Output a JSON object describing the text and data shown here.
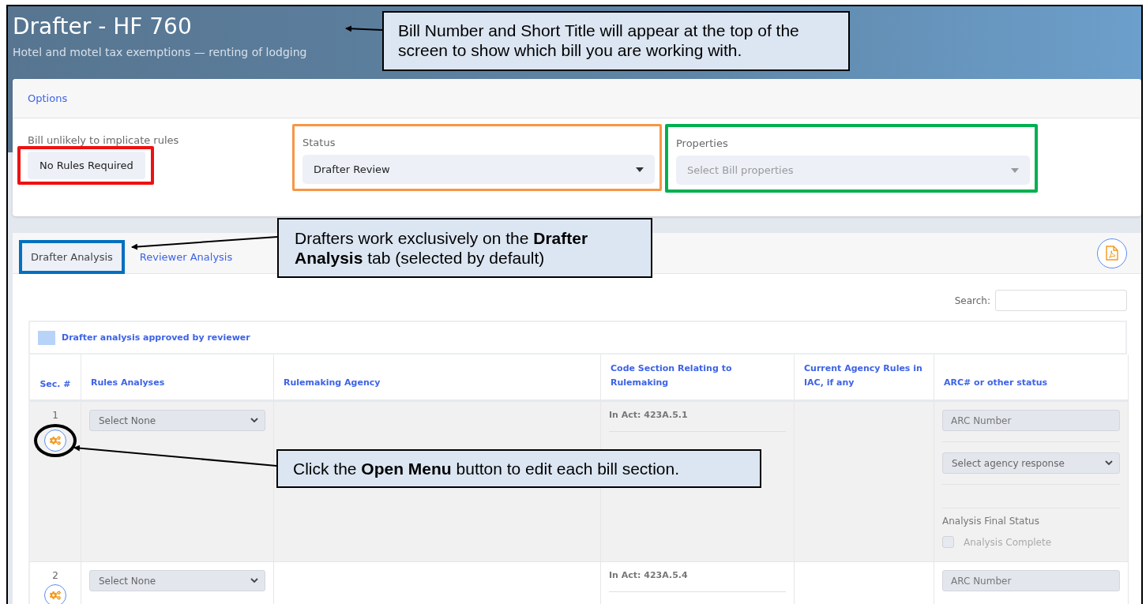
{
  "header": {
    "title": "Drafter - HF 760",
    "subtitle": "Hotel and motel tax exemptions — renting of lodging"
  },
  "options": {
    "heading": "Options",
    "rules": {
      "label": "Bill unlikely to implicate rules",
      "button": "No Rules Required"
    },
    "status": {
      "label": "Status",
      "value": "Drafter Review"
    },
    "properties": {
      "label": "Properties",
      "placeholder": "Select Bill properties"
    }
  },
  "tabs": [
    {
      "label": "Drafter Analysis",
      "selected": true
    },
    {
      "label": "Reviewer Analysis",
      "selected": false
    }
  ],
  "search": {
    "label": "Search:"
  },
  "legend": {
    "label": "Drafter analysis approved by reviewer"
  },
  "table": {
    "columns": [
      "Sec. #",
      "Rules Analyses",
      "Rulemaking Agency",
      "Code Section Relating to Rulemaking",
      "Current Agency Rules in IAC, if any",
      "ARC# or other status"
    ],
    "rows": [
      {
        "section": "1",
        "rules": "Select None",
        "code": "In Act: 423A.5.1",
        "arc_placeholder": "ARC Number",
        "response": "Select agency response",
        "final_status_label": "Analysis Final Status",
        "complete": {
          "label": "Analysis Complete",
          "checked": false,
          "disabled": true
        }
      },
      {
        "section": "2",
        "rules": "Select None",
        "code": "In Act: 423A.5.4",
        "arc_placeholder": "ARC Number"
      }
    ]
  },
  "callouts": [
    {
      "text": "Bill Number and Short Title will appear at the top of the screen to show which bill you are working with."
    },
    {
      "text": "Drafters work exclusively on the **Drafter Analysis** tab (selected by default)"
    },
    {
      "text": "Click the **Open Menu** button to edit each bill section."
    }
  ]
}
